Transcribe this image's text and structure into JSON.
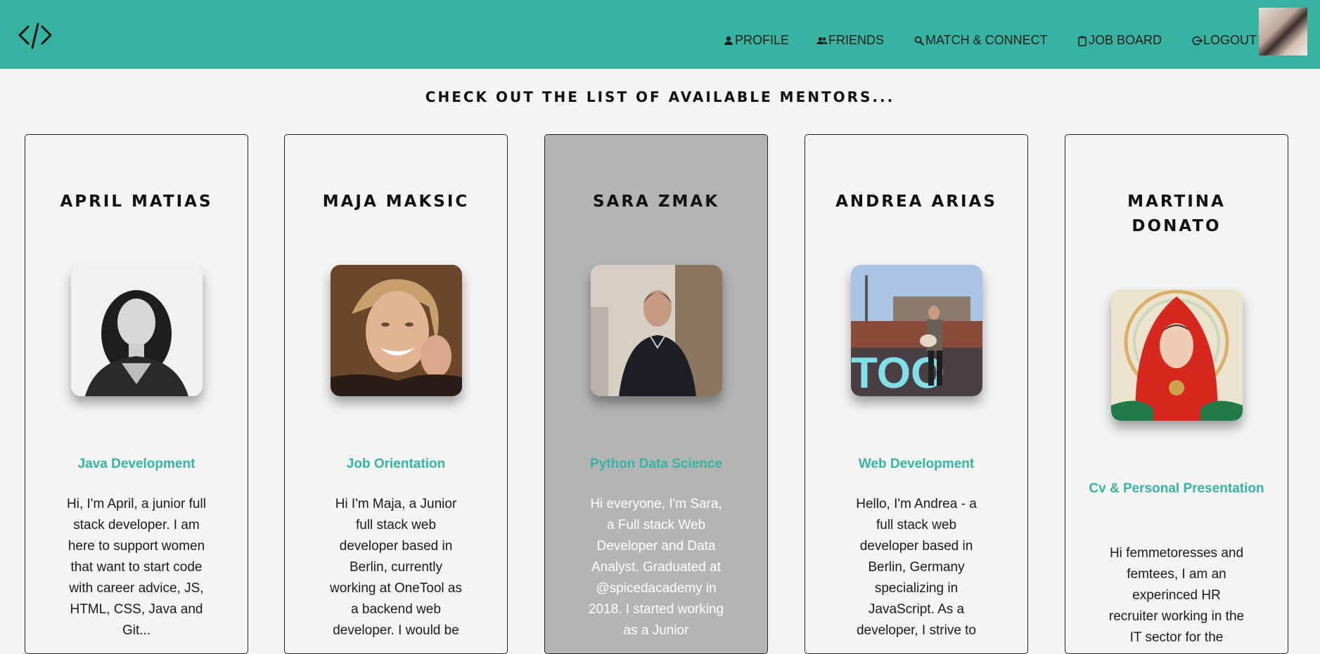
{
  "nav": {
    "items": [
      {
        "label": "PROFILE",
        "icon": "person-icon"
      },
      {
        "label": "FRIENDS",
        "icon": "people-icon"
      },
      {
        "label": "MATCH & CONNECT",
        "icon": "search-icon"
      },
      {
        "label": "JOB BOARD",
        "icon": "clipboard-icon"
      },
      {
        "label": "LOGOUT",
        "icon": "logout-icon"
      }
    ]
  },
  "page": {
    "title": "CHECK OUT THE LIST OF AVAILABLE MENTORS..."
  },
  "mentors": [
    {
      "name": "APRIL MATIAS",
      "topic": "Java Development",
      "bio": "Hi, I'm April, a junior full stack developer. I am here to support women that want to start code with career advice, JS, HTML, CSS, Java and Git..."
    },
    {
      "name": "MAJA MAKSIC",
      "topic": "Job Orientation",
      "bio": "Hi I'm Maja, a Junior full stack web developer based in Berlin, currently working at OneTool as a backend web developer. I would be"
    },
    {
      "name": "SARA ZMAK",
      "topic": "Python Data Science",
      "bio": "Hi everyone, I'm Sara, a Full stack Web Developer and Data Analyst. Graduated at @spicedacademy in 2018. I started working as a Junior"
    },
    {
      "name": "ANDREA ARIAS",
      "topic": "Web Development",
      "bio": "Hello, I'm Andrea - a full stack web developer based in Berlin, Germany specializing in JavaScript. As a developer, I strive to"
    },
    {
      "name": "MARTINA DONATO",
      "topic": "Cv & Personal Presentation",
      "bio": "Hi femmetoresses and femtees, I am an experinced HR recruiter working in the IT sector for the"
    }
  ],
  "colors": {
    "accent": "#36b3a1",
    "background": "#f4f4f4",
    "highlight_card": "#b4b4b4"
  }
}
